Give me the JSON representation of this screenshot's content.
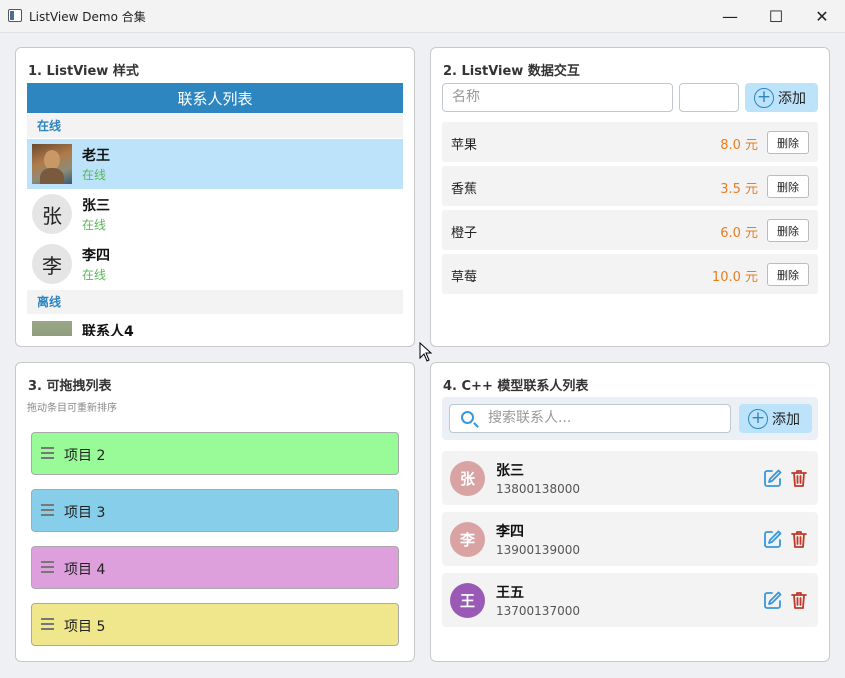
{
  "window": {
    "title": "ListView Demo 合集",
    "minimize": "—",
    "maximize": "☐",
    "close": "✕"
  },
  "panel1": {
    "title": "1. ListView 样式",
    "header": "联系人列表",
    "online_section": "在线",
    "offline_section": "离线",
    "contacts": [
      {
        "name": "老王",
        "status": "在线"
      },
      {
        "name": "张三",
        "status": "在线",
        "avatar": "张"
      },
      {
        "name": "李四",
        "status": "在线",
        "avatar": "李"
      }
    ],
    "offline_contact": {
      "name": "联系人4"
    }
  },
  "panel2": {
    "title": "2. ListView 数据交互",
    "name_placeholder": "名称",
    "add_label": "添加",
    "delete_label": "删除",
    "items": [
      {
        "name": "苹果",
        "price": "8.0 元"
      },
      {
        "name": "香蕉",
        "price": "3.5 元"
      },
      {
        "name": "橙子",
        "price": "6.0 元"
      },
      {
        "name": "草莓",
        "price": "10.0 元"
      }
    ]
  },
  "panel3": {
    "title": "3. 可拖拽列表",
    "subtitle": "拖动条目可重新排序",
    "items": [
      {
        "label": "项目 2",
        "color": "#98fb98"
      },
      {
        "label": "项目 3",
        "color": "#87ceeb"
      },
      {
        "label": "项目 4",
        "color": "#dda0dd"
      },
      {
        "label": "项目 5",
        "color": "#f0e68c"
      }
    ]
  },
  "panel4": {
    "title": "4. C++ 模型联系人列表",
    "search_placeholder": "搜索联系人...",
    "add_label": "添加",
    "contacts": [
      {
        "initial": "张",
        "name": "张三",
        "phone": "13800138000",
        "color": "#d9a3a3"
      },
      {
        "initial": "李",
        "name": "李四",
        "phone": "13900139000",
        "color": "#d9a3a3"
      },
      {
        "initial": "王",
        "name": "王五",
        "phone": "13700137000",
        "color": "#9b59b6"
      }
    ]
  },
  "colors": {
    "accent": "#2e86c1",
    "online": "#5ab55a",
    "price": "#e67e22",
    "delete": "#c0392b",
    "edit": "#3498db"
  }
}
